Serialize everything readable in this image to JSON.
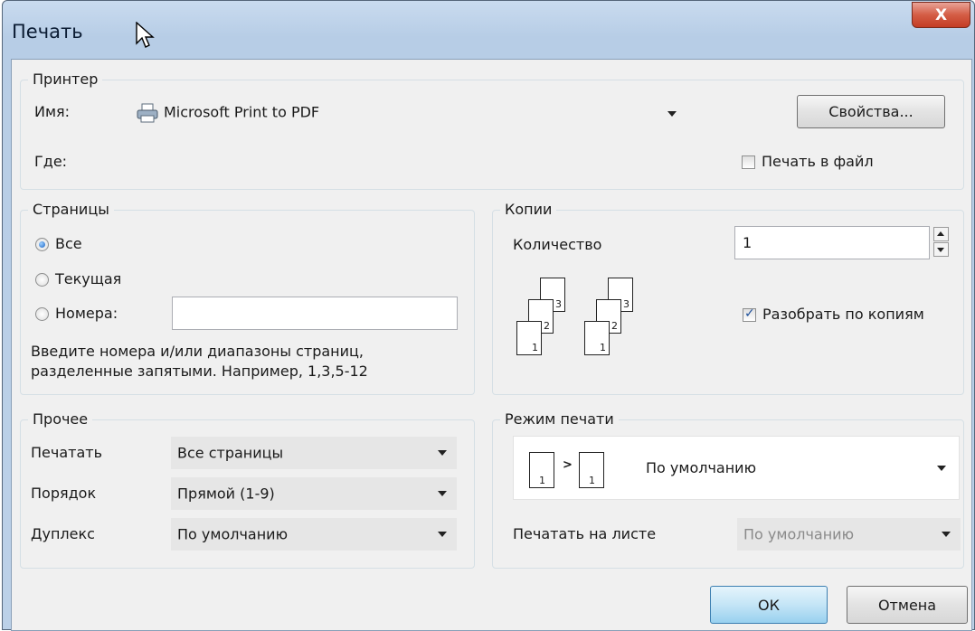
{
  "window": {
    "title": "Печать",
    "close_label": "X"
  },
  "printer": {
    "group_label": "Принтер",
    "name_label": "Имя:",
    "name_value": "Microsoft Print to PDF",
    "where_label": "Где:",
    "properties_button": "Свойства...",
    "print_to_file_label": "Печать в файл",
    "print_to_file_checked": false
  },
  "pages": {
    "group_label": "Страницы",
    "options": [
      {
        "label": "Все",
        "selected": true
      },
      {
        "label": "Текущая",
        "selected": false
      },
      {
        "label": "Номера:",
        "selected": false
      }
    ],
    "numbers_value": "",
    "hint_line1": "Введите номера и/или диапазоны страниц,",
    "hint_line2": "разделенные запятыми. Например, 1,3,5-12"
  },
  "copies": {
    "group_label": "Копии",
    "count_label": "Количество",
    "count_value": "1",
    "collate_label": "Разобрать по копиям",
    "collate_checked": true,
    "illustration_pages": [
      "1",
      "2",
      "3"
    ]
  },
  "other": {
    "group_label": "Прочее",
    "rows": [
      {
        "label": "Печатать",
        "value": "Все страницы"
      },
      {
        "label": "Порядок",
        "value": "Прямой (1-9)"
      },
      {
        "label": "Дуплекс",
        "value": "По умолчанию"
      }
    ]
  },
  "print_mode": {
    "group_label": "Режим печати",
    "mode_value": "По умолчанию",
    "mode_pages": [
      "1",
      "1"
    ],
    "per_sheet_label": "Печатать на листе",
    "per_sheet_value": "По умолчанию"
  },
  "buttons": {
    "ok": "ОК",
    "cancel": "Отмена"
  },
  "colors": {
    "accent": "#1863c4",
    "title_bar": "#bcd1e8",
    "close_button": "#c43c24",
    "ok_highlight": "#bfe0f7"
  }
}
